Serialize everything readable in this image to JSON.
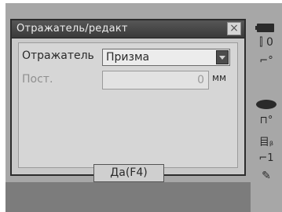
{
  "dialog": {
    "title": "Отражатель/редакт",
    "close_symbol": "×",
    "reflector_label": "Отражатель",
    "reflector_value": "Призма",
    "const_label": "Пост.",
    "const_value": "0",
    "const_unit": "мм",
    "ok_label": "Да(F4)"
  },
  "status": {
    "signal": "ₗ₀",
    "zero": "0",
    "tilt": "⌐°",
    "prism_value": "⏤",
    "laser": "⊓°",
    "mode": "目ᵦ",
    "slot": "⌐1",
    "input": "✎"
  }
}
